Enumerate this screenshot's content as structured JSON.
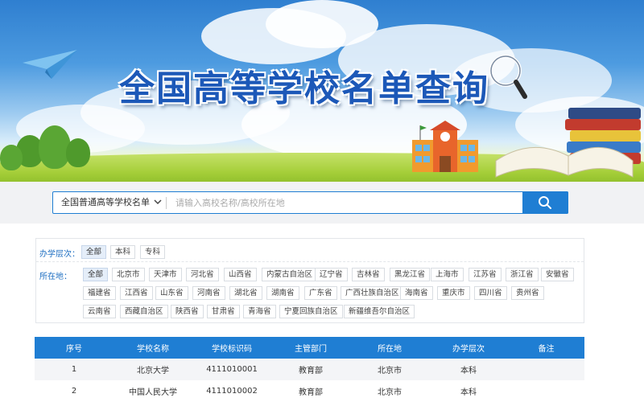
{
  "banner": {
    "title": "全国高等学校名单查询"
  },
  "search": {
    "scope_label": "全国普通高等学校名单",
    "placeholder": "请输入高校名称/高校所在地"
  },
  "filters": {
    "level": {
      "label": "办学层次：",
      "options": [
        "全部",
        "本科",
        "专科"
      ],
      "selected": "全部"
    },
    "location": {
      "label": "所在地：",
      "options": [
        "全部",
        "北京市",
        "天津市",
        "河北省",
        "山西省",
        "内蒙古自治区",
        "辽宁省",
        "吉林省",
        "黑龙江省",
        "上海市",
        "江苏省",
        "浙江省",
        "安徽省",
        "福建省",
        "江西省",
        "山东省",
        "河南省",
        "湖北省",
        "湖南省",
        "广东省",
        "广西壮族自治区",
        "海南省",
        "重庆市",
        "四川省",
        "贵州省",
        "云南省",
        "西藏自治区",
        "陕西省",
        "甘肃省",
        "青海省",
        "宁夏回族自治区",
        "新疆维吾尔自治区"
      ],
      "selected": "全部"
    }
  },
  "table": {
    "headers": [
      "序号",
      "学校名称",
      "学校标识码",
      "主管部门",
      "所在地",
      "办学层次",
      "备注"
    ],
    "rows": [
      [
        "1",
        "北京大学",
        "4111010001",
        "教育部",
        "北京市",
        "本科",
        ""
      ],
      [
        "2",
        "中国人民大学",
        "4111010002",
        "教育部",
        "北京市",
        "本科",
        ""
      ]
    ]
  },
  "colors": {
    "primary": "#1f7ed3",
    "title_blue": "#1c58b8",
    "chip_active_bg": "#e5eef9"
  }
}
